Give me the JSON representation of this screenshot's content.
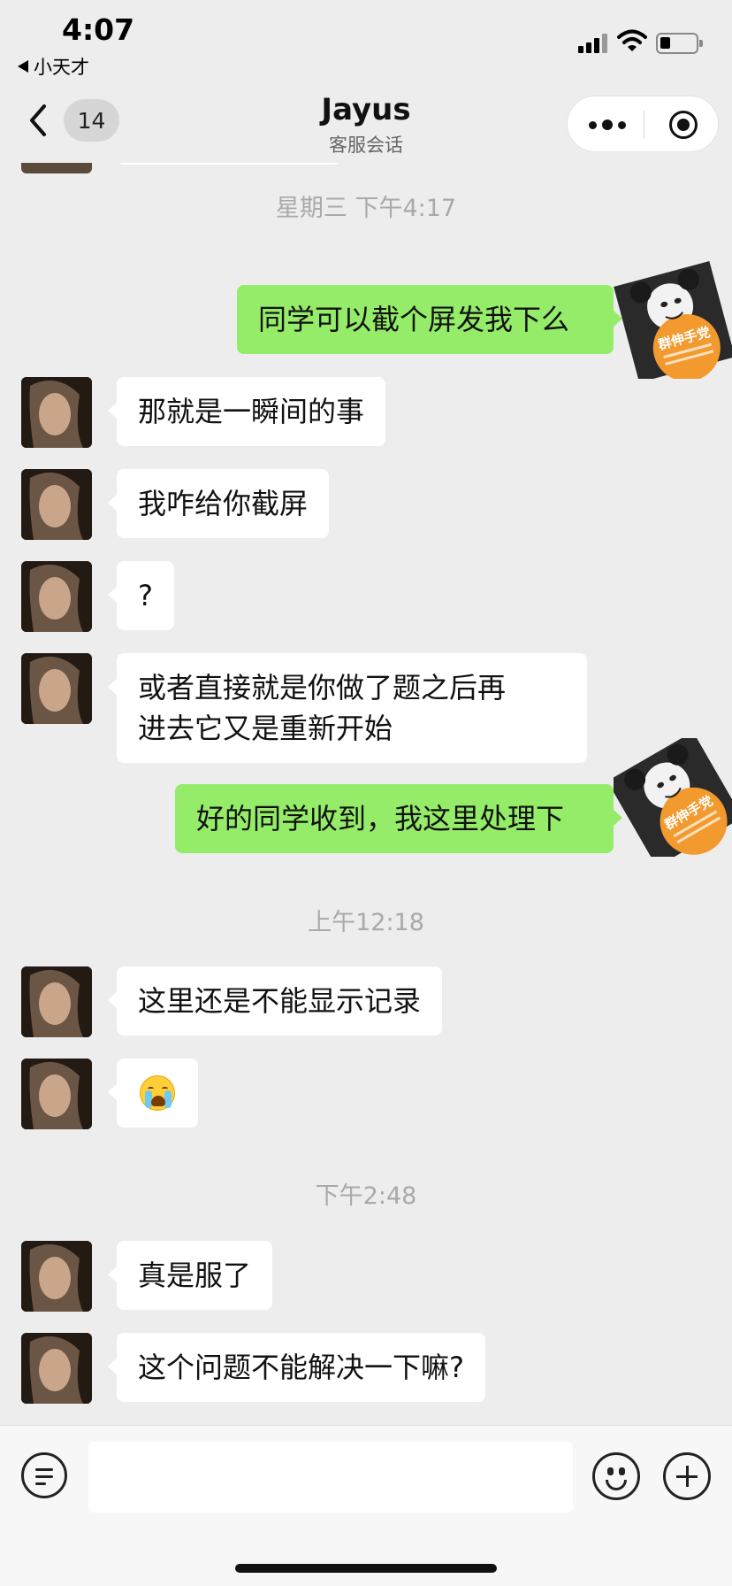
{
  "status_bar": {
    "time": "4:07",
    "back_app": "小天才",
    "icons": [
      "signal-icon",
      "wifi-icon",
      "battery-icon"
    ],
    "battery_level": 0.25
  },
  "nav": {
    "back_icon": "chevron-left-icon",
    "unread_count": "14",
    "title": "Jayus",
    "subtitle": "客服会话",
    "capsule_icons": [
      "more-dots-icon",
      "close-target-icon"
    ]
  },
  "messages": [
    {
      "type": "time",
      "text": "星期三 下午4:17"
    },
    {
      "type": "sent",
      "text": "同学可以截个屏发我下么",
      "sticker_text": "群伸手党"
    },
    {
      "type": "received",
      "text": "那就是一瞬间的事"
    },
    {
      "type": "received",
      "text": "我咋给你截屏"
    },
    {
      "type": "received",
      "text": "?"
    },
    {
      "type": "received",
      "text": "或者直接就是你做了题之后再进去它又是重新开始"
    },
    {
      "type": "sent",
      "text": "好的同学收到，我这里处理下",
      "sticker_text": "群伸手党"
    },
    {
      "type": "time",
      "text": "上午12:18"
    },
    {
      "type": "received",
      "text": "这里还是不能显示记录"
    },
    {
      "type": "received",
      "emoji": "crying-face-emoji"
    },
    {
      "type": "time",
      "text": "下午2:48"
    },
    {
      "type": "received",
      "text": "真是服了"
    },
    {
      "type": "received",
      "text": "这个问题不能解决一下嘛?"
    }
  ],
  "text_lines": {
    "m5_line1": "或者直接就是你做了题之后再",
    "m5_line2": "进去它又是重新开始"
  },
  "input_bar": {
    "icons": [
      "quick-menu-icon",
      "emoji-icon",
      "plus-icon"
    ],
    "text_value": ""
  },
  "colors": {
    "background": "#ededed",
    "sent_bubble": "#95ec69",
    "received_bubble": "#ffffff",
    "timestamp": "#a9a9a9"
  }
}
